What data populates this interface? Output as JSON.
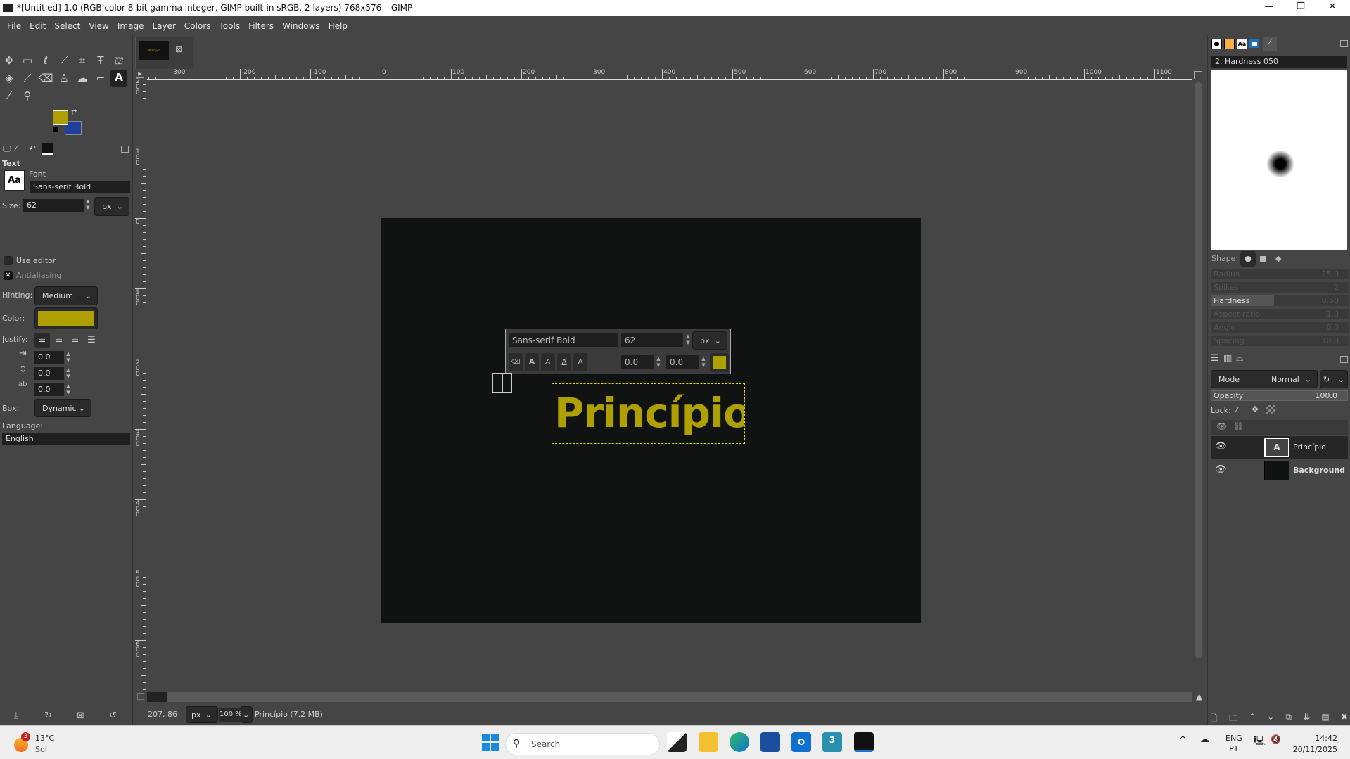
{
  "window": {
    "title": "*[Untitled]-1.0 (RGB color 8-bit gamma integer, GIMP built-in sRGB, 2 layers) 768x576 – GIMP",
    "minimize": "—",
    "maximize": "❐",
    "close": "✕"
  },
  "menu": [
    "File",
    "Edit",
    "Select",
    "View",
    "Image",
    "Layer",
    "Colors",
    "Tools",
    "Filters",
    "Windows",
    "Help"
  ],
  "colors": {
    "fg": "#ada000",
    "bg": "#1f3f9f",
    "text_color": "#ada000",
    "canvas": "#111312"
  },
  "tool_options": {
    "title": "Text",
    "font_label": "Font",
    "font": "Sans-serif Bold",
    "font_icon": "Aa",
    "size_label": "Size:",
    "size": "62",
    "size_unit": "px",
    "use_editor": "Use editor",
    "use_editor_checked": false,
    "antialiasing": "Antialiasing",
    "antialiasing_checked": true,
    "hinting_label": "Hinting:",
    "hinting": "Medium",
    "color_label": "Color:",
    "justify_label": "Justify:",
    "indent": "0.0",
    "line_spacing": "0.0",
    "letter_spacing": "0.0",
    "box_label": "Box:",
    "box": "Dynamic",
    "language_label": "Language:",
    "language": "English"
  },
  "image_tab": {
    "thumb_text": "Princípio"
  },
  "ruler": {
    "h": [
      "-300",
      "-200",
      "-100",
      "0",
      "100",
      "200",
      "300",
      "400",
      "500",
      "600",
      "700",
      "800",
      "900",
      "1000",
      "1100"
    ],
    "v": [
      "-200",
      "-100",
      "0",
      "100",
      "200",
      "300",
      "400",
      "500",
      "600"
    ]
  },
  "text_toolbar": {
    "font": "Sans-serif Bold",
    "size": "62",
    "unit": "px",
    "baseline": "0.0",
    "kerning": "0.0"
  },
  "canvas_text": "Princípio",
  "status": {
    "coords": "207, 86",
    "unit": "px",
    "zoom": "100 %",
    "info": "Princípio (7.2 MB)"
  },
  "brushes": {
    "name": "2. Hardness 050",
    "shape_label": "Shape:",
    "sliders": [
      {
        "label": "Radius",
        "value": "25.0"
      },
      {
        "label": "Spikes",
        "value": "2"
      },
      {
        "label": "Hardness",
        "value": "0.50"
      },
      {
        "label": "Aspect ratio",
        "value": "1.0"
      },
      {
        "label": "Angle",
        "value": "0.0"
      },
      {
        "label": "Spacing",
        "value": "10.0"
      }
    ]
  },
  "layers": {
    "mode_label": "Mode",
    "mode": "Normal",
    "opacity_label": "Opacity",
    "opacity": "100.0",
    "lock_label": "Lock:",
    "items": [
      {
        "name": "Princípio",
        "visible": true,
        "selected": true
      },
      {
        "name": "Background",
        "visible": true,
        "selected": false
      }
    ]
  },
  "taskbar": {
    "weather_temp": "13°C",
    "weather_desc": "Sol",
    "weather_badge": "3",
    "search": "Search",
    "lang1": "ENG",
    "lang2": "PT",
    "time": "14:42",
    "date": "20/11/2025"
  }
}
